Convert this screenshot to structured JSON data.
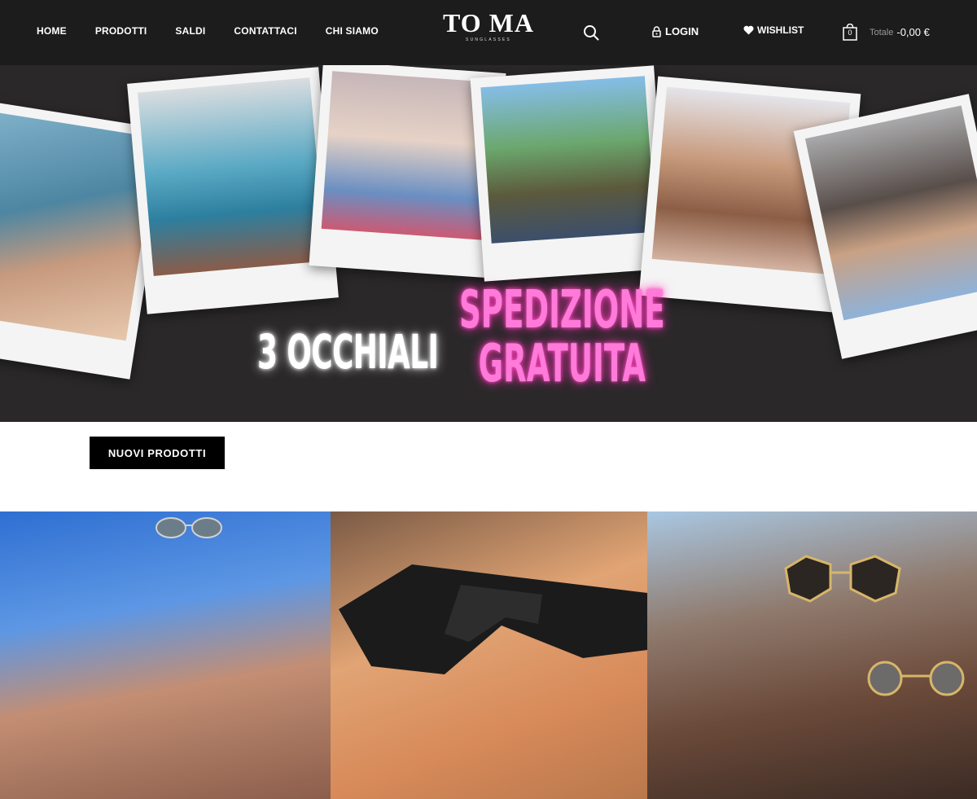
{
  "header": {
    "nav": [
      "HOME",
      "PRODOTTI",
      "SALDI",
      "CONTATTACI",
      "CHI SIAMO"
    ],
    "logo": {
      "main": "TO MA",
      "sub": "SUNGLASSES"
    },
    "login_label": "LOGIN",
    "wishlist_label": "WISHLIST",
    "cart": {
      "count": "0",
      "label": "Totale",
      "total": "-0,00 €"
    }
  },
  "hero": {
    "promo_left": "3 OCCHIALI",
    "promo_right_line1": "SPEDIZIONE",
    "promo_right_line2": "GRATUITA"
  },
  "section": {
    "button_label": "NUOVI PRODOTTI"
  },
  "colors": {
    "header_bg": "#1c1c1c",
    "hero_bg": "#2a2829",
    "neon_pink": "#ff7ad9",
    "button_bg": "#000000"
  },
  "icons": [
    "search-icon",
    "lock-icon",
    "heart-icon",
    "shopping-bag-icon"
  ]
}
